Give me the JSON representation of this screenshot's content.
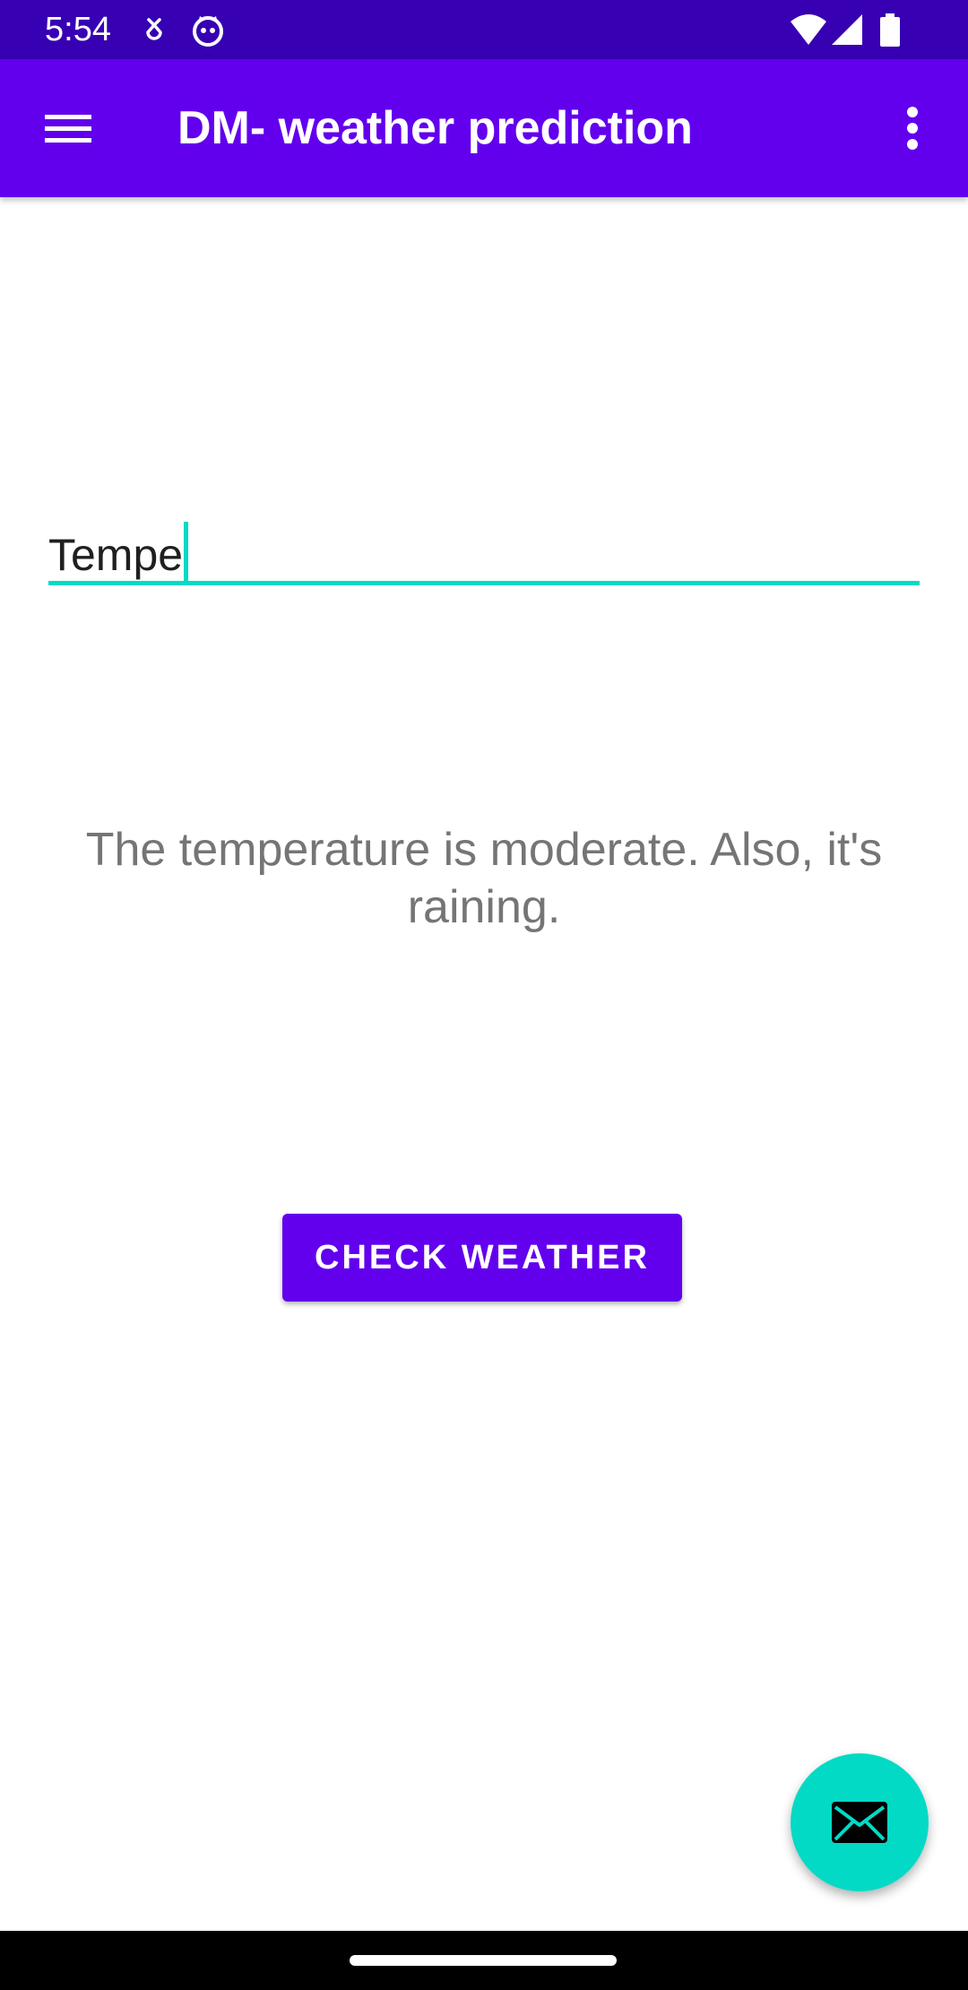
{
  "status_bar": {
    "time": "5:54",
    "icons": [
      "download-icon",
      "cat-face-icon",
      "wifi-icon",
      "cellular-signal-icon",
      "battery-icon"
    ]
  },
  "app_bar": {
    "title": "DM- weather prediction",
    "menu_icon": "hamburger-menu-icon",
    "overflow_icon": "more-vert-icon"
  },
  "input": {
    "value": "Tempe",
    "underline_color": "#03dac5"
  },
  "result": {
    "text": "The temperature is moderate. Also, it's raining."
  },
  "button": {
    "label": "CHECK WEATHER"
  },
  "fab": {
    "icon": "email-icon"
  },
  "colors": {
    "primary": "#6200ee",
    "primary_dark": "#3700b3",
    "accent": "#03dac5",
    "result_text": "#757575"
  }
}
